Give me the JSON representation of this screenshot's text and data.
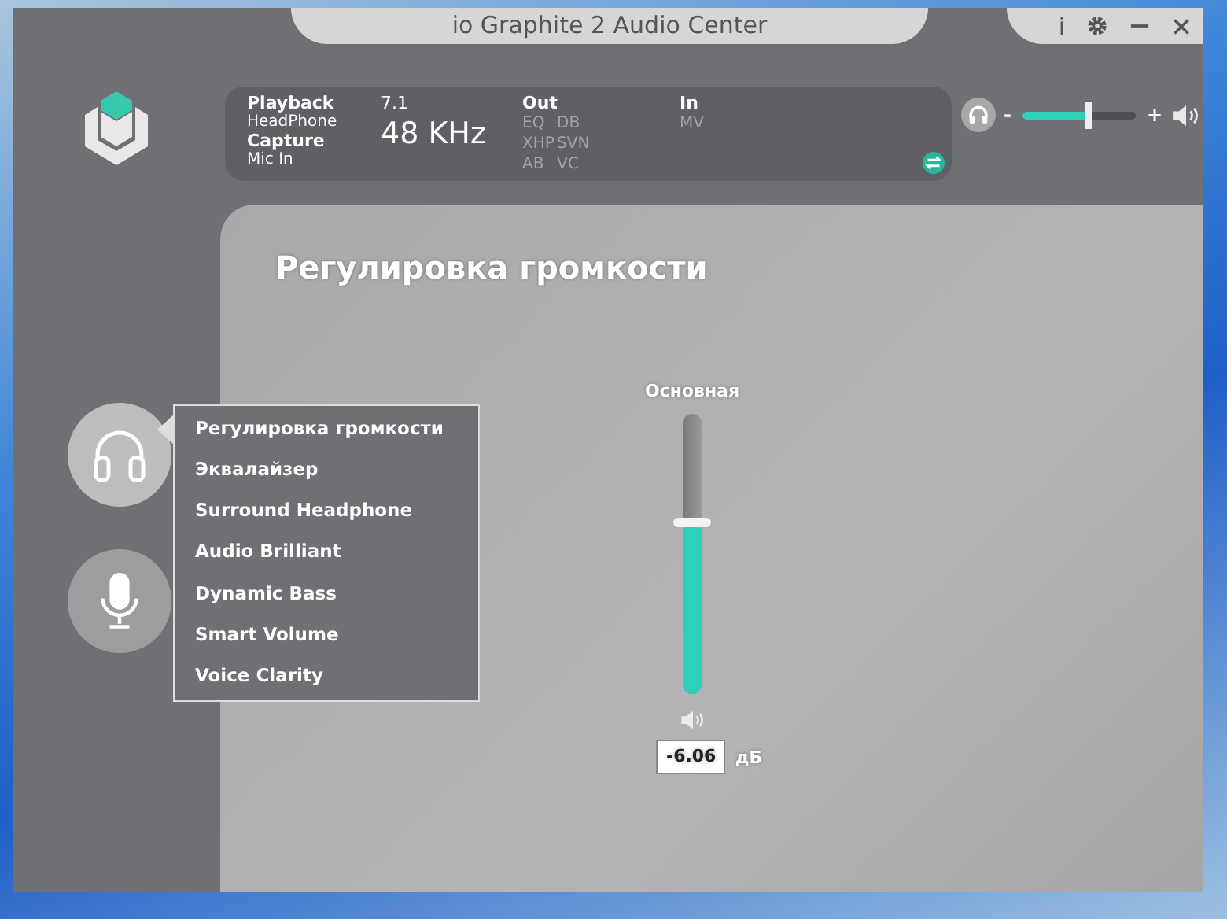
{
  "window": {
    "title": "io Graphite 2 Audio Center",
    "info": "i"
  },
  "status": {
    "playback_label": "Playback",
    "playback_device": "HeadPhone",
    "capture_label": "Capture",
    "capture_device": "Mic In",
    "channels": "7.1",
    "sample_rate": "48 KHz",
    "out": {
      "label": "Out",
      "effects": [
        {
          "label": "EQ",
          "on": false
        },
        {
          "label": "DB",
          "on": false
        },
        {
          "label": "XHP",
          "on": false
        },
        {
          "label": "SVN",
          "on": false
        },
        {
          "label": "AB",
          "on": false
        },
        {
          "label": "VC",
          "on": false
        }
      ]
    },
    "in": {
      "label": "In",
      "effects": [
        {
          "label": "MV",
          "on": false
        }
      ]
    }
  },
  "master_volume": {
    "minus": "-",
    "plus": "+",
    "level": 0.58
  },
  "devices": [
    {
      "kind": "headphones",
      "selected": true
    },
    {
      "kind": "microphone",
      "selected": false
    }
  ],
  "menu": {
    "items": [
      {
        "label": "Регулировка громкости"
      },
      {
        "label": "Эквалайзер"
      },
      {
        "label": "Surround Headphone"
      },
      {
        "label": "Audio Brilliant"
      },
      {
        "label": "Dynamic Bass"
      },
      {
        "label": "Smart Volume"
      },
      {
        "label": "Voice Clarity"
      }
    ]
  },
  "page": {
    "title": "Регулировка громкости",
    "slider": {
      "label": "Основная",
      "level": 0.61,
      "value": "-6.06",
      "unit": "дБ"
    }
  }
}
